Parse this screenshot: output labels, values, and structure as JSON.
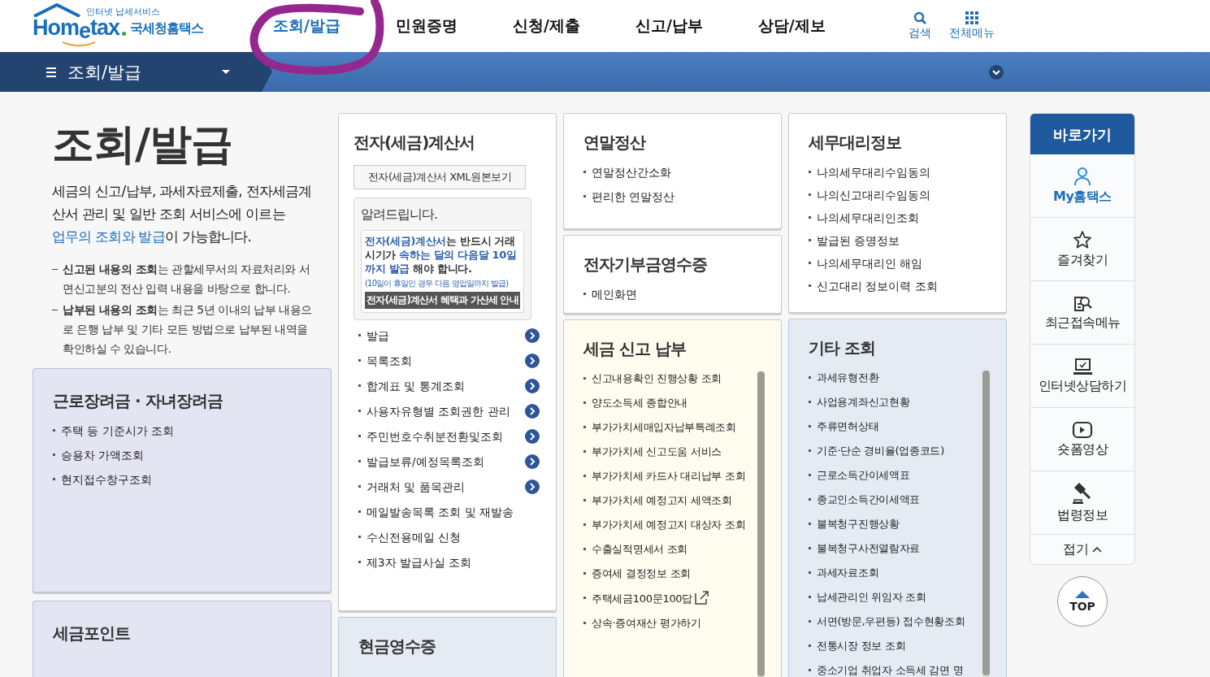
{
  "header": {
    "logo": {
      "tagline": "인터넷 납세서비스",
      "wordmark": [
        "Hom",
        "e",
        "tax"
      ],
      "name": "국세청홈택스"
    },
    "nav": [
      {
        "label": "조회/발급",
        "selected": true
      },
      {
        "label": "민원증명",
        "selected": false
      },
      {
        "label": "신청/제출",
        "selected": false
      },
      {
        "label": "신고/납부",
        "selected": false
      },
      {
        "label": "상담/제보",
        "selected": false
      }
    ],
    "tools": [
      {
        "kind": "search",
        "label": "검색"
      },
      {
        "kind": "grid",
        "label": "전체메뉴"
      }
    ]
  },
  "annotation": {
    "kind": "circle"
  },
  "menu_bar": {
    "label": "조회/발급"
  },
  "intro": {
    "title": "조회/발급",
    "lead": "세금의 신고/납부, 과세자료제출, 전자세금계산서 관리 및 일반 조회 서비스에 이르는 ",
    "link": "업무의 조회와 발급",
    "tail": "이 가능합니다.",
    "notes": [
      "**신고된 내용의 조회**는 관할세무서의 자료처리와 서면신고분의 전산 입력 내용을 바탕으로 합니다.",
      "**납부된 내용의 조회**는 최근 5년 이내의 납부 내용으로 은행 납부 및 기타 모든 방법으로 납부된 내역을 확인하실 수 있습니다."
    ]
  },
  "columns": [
    [
      {
        "title": "근로장려금 · 자녀장려금",
        "items": [
          {
            "label": "주택 등 기준시가 조회"
          },
          {
            "label": "승용차 가액조회"
          },
          {
            "label": "현지접수창구조회"
          }
        ]
      },
      {
        "title": "세금포인트"
      }
    ],
    [
      {
        "title": "전자(세금)계산서",
        "button": "전자(세금)계산서 XML원본보기",
        "notice": {
          "title": "알려드립니다.",
          "text": "**전자(세금)계산서**는 반드시 거래시기가 **속하는 달의 다음달 10일까지 발급** 해야 합니다.",
          "footnote": "(10일이 휴일인 경우 다음 영업일까지 발급)",
          "link": "전자(세금)계산서 혜택과 가산세 안내"
        },
        "items": [
          {
            "label": "발급",
            "arrow": true
          },
          {
            "label": "목록조회",
            "arrow": true
          },
          {
            "label": "합계표 및 통계조회",
            "arrow": true
          },
          {
            "label": "사용자유형별 조회권한 관리",
            "arrow": true
          },
          {
            "label": "주민번호수취분전환및조회",
            "arrow": true
          },
          {
            "label": "발급보류/예정목록조회",
            "arrow": true
          },
          {
            "label": "거래처 및 품목관리",
            "arrow": true
          },
          {
            "label": "메일발송목록 조회 및 재발송",
            "arrow": false
          },
          {
            "label": "수신전용메일 신청",
            "arrow": false
          },
          {
            "label": "제3자 발급사실 조회",
            "arrow": false
          }
        ]
      },
      {
        "title": "현금영수증"
      }
    ],
    [
      {
        "title": "연말정산",
        "items": [
          {
            "label": "연말정산간소화"
          },
          {
            "label": "편리한 연말정산"
          }
        ]
      },
      {
        "title": "전자기부금영수증",
        "items": [
          {
            "label": "메인화면"
          }
        ]
      },
      {
        "title": "세금 신고 납부",
        "scroll": true,
        "items": [
          {
            "label": "신고내용확인 진행상황 조회"
          },
          {
            "label": "양도소득세 종합안내"
          },
          {
            "label": "부가가치세매입자납부특례조회"
          },
          {
            "label": "부가가치세 신고도움 서비스"
          },
          {
            "label": "부가가치세 카드사 대리납부 조회"
          },
          {
            "label": "부가가치세 예정고지 세액조회"
          },
          {
            "label": "부가가치세 예정고지 대상자 조회"
          },
          {
            "label": "수출실적명세서 조회"
          },
          {
            "label": "증여세 결정정보 조회"
          },
          {
            "label": "주택세금100문100답",
            "external": true
          },
          {
            "label": "상속·증여재산 평가하기"
          }
        ]
      }
    ],
    [
      {
        "title": "세무대리정보",
        "items": [
          {
            "label": "나의세무대리수임동의"
          },
          {
            "label": "나의신고대리수임동의"
          },
          {
            "label": "나의세무대리인조회"
          },
          {
            "label": "발급된 증명정보"
          },
          {
            "label": "나의세무대리인 해임"
          },
          {
            "label": "신고대리 정보이력 조회"
          }
        ]
      },
      {
        "title": "기타 조회",
        "scroll": true,
        "items": [
          {
            "label": "과세유형전환"
          },
          {
            "label": "사업용계좌신고현황"
          },
          {
            "label": "주류면허상태"
          },
          {
            "label": "기준·단순 경비율(업종코드)"
          },
          {
            "label": "근로소득간이세액표"
          },
          {
            "label": "종교인소득간이세액표"
          },
          {
            "label": "불복청구진행상황"
          },
          {
            "label": "불복청구사전열람자료"
          },
          {
            "label": "과세자료조회"
          },
          {
            "label": "납세관리인 위임자 조회"
          },
          {
            "label": "서면(방문,우편등) 접수현황조회"
          },
          {
            "label": "전통시장 정보 조회"
          },
          {
            "label": "중소기업 취업자 소득세 감면 명"
          }
        ]
      }
    ]
  ],
  "quick_links": {
    "title": "바로가기",
    "items": [
      {
        "kind": "user",
        "label": "My홈택스",
        "accent": true
      },
      {
        "kind": "star",
        "label": "즐겨찾기",
        "accent": false
      },
      {
        "kind": "recent",
        "label": "최근접속메뉴",
        "accent": false
      },
      {
        "kind": "laptop",
        "label": "인터넷상담하기",
        "accent": false
      },
      {
        "kind": "video",
        "label": "숏폼영상",
        "accent": false
      },
      {
        "kind": "gavel",
        "label": "법령정보",
        "accent": false
      }
    ],
    "collapse": "접기"
  },
  "top_button": "TOP"
}
